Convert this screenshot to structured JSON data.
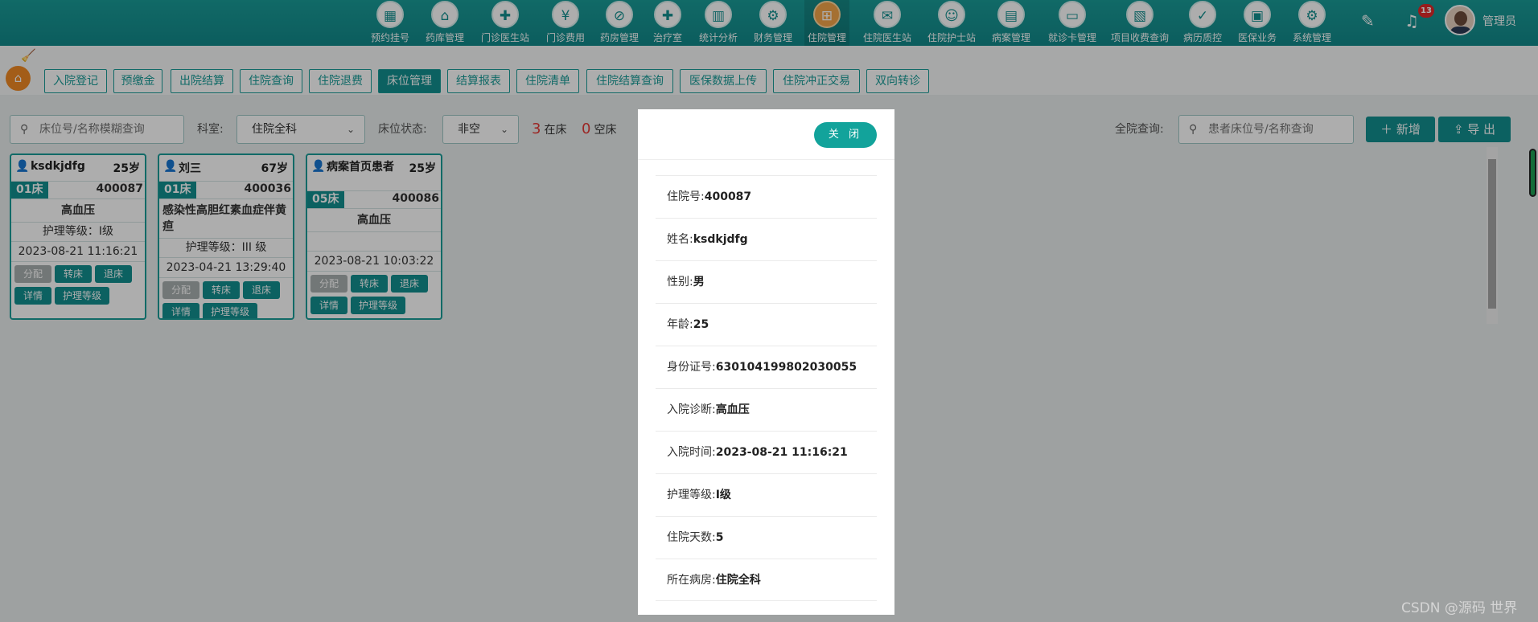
{
  "topnav": [
    {
      "label": "预约挂号",
      "icon": "calendar-icon",
      "glyph": "▦"
    },
    {
      "label": "药库管理",
      "icon": "warehouse-icon",
      "glyph": "⌂"
    },
    {
      "label": "门诊医生站",
      "icon": "doctor-icon",
      "glyph": "✚"
    },
    {
      "label": "门诊费用",
      "icon": "yen-icon",
      "glyph": "¥"
    },
    {
      "label": "药房管理",
      "icon": "pill-icon",
      "glyph": "⊘"
    },
    {
      "label": "治疗室",
      "icon": "treatment-icon",
      "glyph": "✚"
    },
    {
      "label": "统计分析",
      "icon": "chart-icon",
      "glyph": "▥"
    },
    {
      "label": "财务管理",
      "icon": "finance-icon",
      "glyph": "⚙"
    },
    {
      "label": "住院管理",
      "icon": "bed-icon",
      "glyph": "⊞"
    },
    {
      "label": "住院医生站",
      "icon": "inpatient-doctor-icon",
      "glyph": "✉"
    },
    {
      "label": "住院护士站",
      "icon": "nurse-icon",
      "glyph": "☺"
    },
    {
      "label": "病案管理",
      "icon": "record-icon",
      "glyph": "▤"
    },
    {
      "label": "就诊卡管理",
      "icon": "card-icon",
      "glyph": "▭"
    },
    {
      "label": "项目收费查询",
      "icon": "fee-icon",
      "glyph": "▧"
    },
    {
      "label": "病历质控",
      "icon": "quality-icon",
      "glyph": "✓"
    },
    {
      "label": "医保业务",
      "icon": "insurance-icon",
      "glyph": "▣"
    },
    {
      "label": "系统管理",
      "icon": "system-icon",
      "glyph": "⚙"
    }
  ],
  "active_nav": "住院管理",
  "notifications": {
    "count": "13"
  },
  "user": {
    "name": "管理员"
  },
  "tabs": [
    {
      "label": "入院登记"
    },
    {
      "label": "预缴金"
    },
    {
      "label": "出院结算"
    },
    {
      "label": "住院查询"
    },
    {
      "label": "住院退费"
    },
    {
      "label": "床位管理"
    },
    {
      "label": "结算报表"
    },
    {
      "label": "住院清单"
    },
    {
      "label": "住院结算查询"
    },
    {
      "label": "医保数据上传"
    },
    {
      "label": "住院冲正交易"
    },
    {
      "label": "双向转诊"
    }
  ],
  "active_tab": "床位管理",
  "filters": {
    "search_placeholder": "床位号/名称模糊查询",
    "dept_label": "科室:",
    "dept_value": "住院全科",
    "status_label": "床位状态:",
    "status_value": "非空",
    "occupied_count": "3",
    "occupied_label": "在床",
    "empty_count": "0",
    "empty_label": "空床",
    "global_label": "全院查询:",
    "global_placeholder": "患者床位号/名称查询",
    "add_label": "新增",
    "export_label": "导 出"
  },
  "cards": [
    {
      "name": "ksdkjdfg",
      "age": "25岁",
      "bed": "01床",
      "no": "400087",
      "diagnosis": "高血压",
      "nurse": "护理等级：I级",
      "time": "2023-08-21 11:16:21"
    },
    {
      "name": "刘三",
      "age": "67岁",
      "bed": "01床",
      "no": "400036",
      "diagnosis": "感染性高胆红素血症伴黄疸",
      "nurse": "护理等级：III 级",
      "time": "2023-04-21 13:29:40"
    },
    {
      "name": "病案首页患者",
      "age": "25岁",
      "bed": "05床",
      "no": "400086",
      "diagnosis": "高血压",
      "nurse": "",
      "time": "2023-08-21 10:03:22"
    }
  ],
  "card_ops": {
    "assign": "分配",
    "transfer": "转床",
    "leave": "退床",
    "detail": "详情",
    "nurse_level": "护理等级"
  },
  "modal": {
    "close_label": "关 闭",
    "rows": [
      {
        "key": "住院号:",
        "value": "400087"
      },
      {
        "key": "姓名:",
        "value": "ksdkjdfg"
      },
      {
        "key": "性别:",
        "value": "男"
      },
      {
        "key": "年龄:",
        "value": "25"
      },
      {
        "key": "身份证号:",
        "value": "630104199802030055"
      },
      {
        "key": "入院诊断:",
        "value": "高血压"
      },
      {
        "key": "入院时间:",
        "value": "2023-08-21 11:16:21"
      },
      {
        "key": "护理等级:",
        "value": "I级"
      },
      {
        "key": "住院天数:",
        "value": "5"
      },
      {
        "key": "所在病房:",
        "value": "住院全科"
      }
    ]
  },
  "watermark": "CSDN @源码 世界",
  "colors": {
    "primary": "#129090",
    "accent_orange": "#f08a24",
    "danger": "#e53935"
  }
}
